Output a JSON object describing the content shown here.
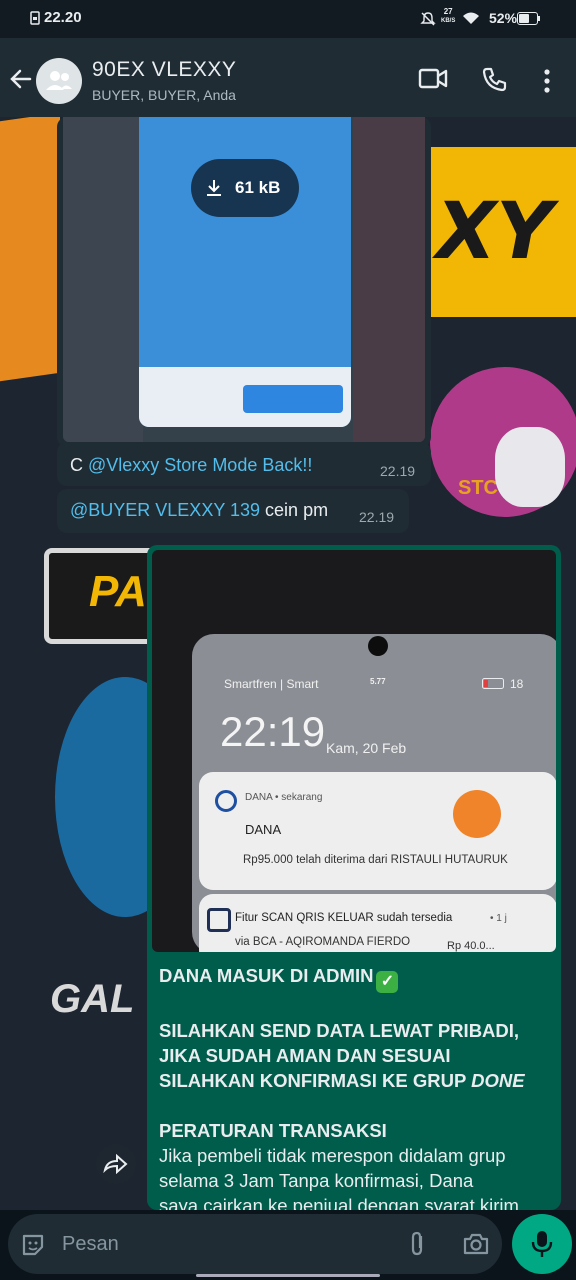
{
  "status_bar": {
    "time": "22.20",
    "network_speed_top": "27",
    "network_speed_bottom": "KB/S",
    "battery": "52%"
  },
  "header": {
    "title": "90EX VLEXXY",
    "subtitle": "BUYER, BUYER, Anda"
  },
  "messages": [
    {
      "type": "image-incoming",
      "download_size": "61 kB"
    },
    {
      "type": "text-incoming",
      "prefix": "C ",
      "mention": "@Vlexxy Store Mode Back!!",
      "text": "",
      "time": "22.19"
    },
    {
      "type": "text-incoming",
      "prefix": "",
      "mention": "@BUYER VLEXXY 139",
      "text": " cein pm",
      "time": "22.19"
    }
  ],
  "outgoing": {
    "screenshot": {
      "carrier": "Smartfren | Smart",
      "speed": "5.77",
      "battery": "18",
      "clock": "22:19",
      "date": "Kam, 20 Feb",
      "notif1_app": "DANA • sekarang",
      "notif1_title": "DANA",
      "notif1_body": "Rp95.000 telah diterima dari RISTAULI HUTAURUK",
      "notif2_title": "Fitur SCAN QRIS KELUAR sudah tersedia",
      "notif2_time": "• 1 j",
      "notif2_body": "via BCA - AQIROMANDA FIERDO",
      "notif2_amount": "Rp 40.0..."
    },
    "line1": "DANA MASUK DI ADMIN",
    "line2": "SILAHKAN SEND DATA LEWAT PRIBADI,",
    "line3": "JIKA SUDAH AMAN DAN SESUAI",
    "line4a": "SILAHKAN KONFIRMASI KE GRUP ",
    "line4b": "DONE",
    "line5": "PERATURAN TRANSAKSI",
    "line6": "Jika pembeli tidak merespon didalam grup",
    "line7": "selama 3 Jam Tanpa konfirmasi, Dana",
    "line8": "saya cairkan ke penjual dengan syarat kirim"
  },
  "wallpaper": {
    "text_left_1": "PA",
    "text_left_2": "GAL",
    "text_right": "XY",
    "text_right_2": "STC"
  },
  "composer": {
    "placeholder": "Pesan"
  },
  "colors": {
    "app_bar": "#1f2c34",
    "outgoing_bubble": "#005c4b",
    "mention": "#53bdeb",
    "mic_button": "#00a884"
  }
}
